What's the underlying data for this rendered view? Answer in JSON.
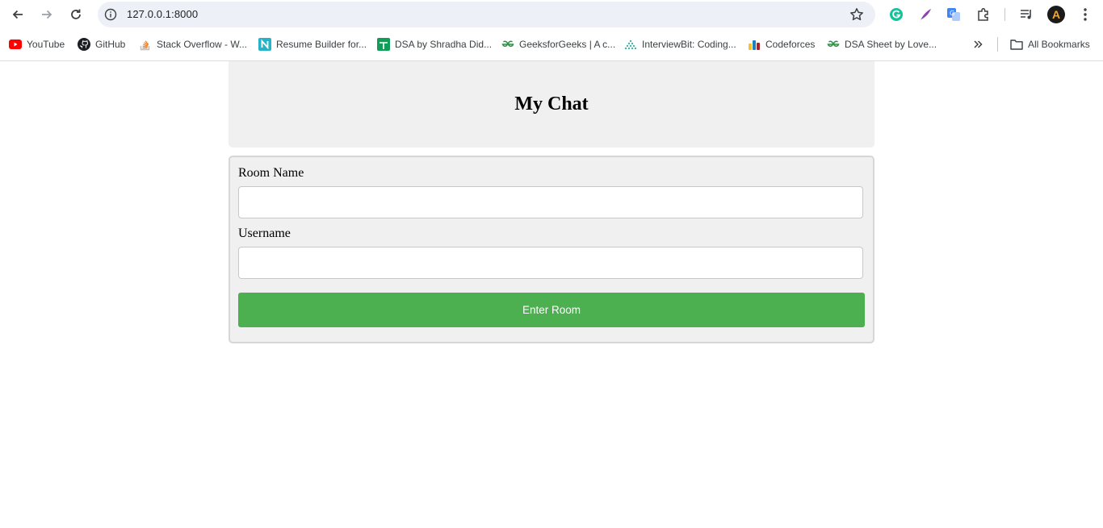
{
  "browser": {
    "url": "127.0.0.1:8000",
    "bookmarks": [
      {
        "label": "YouTube",
        "icon": "youtube-icon"
      },
      {
        "label": "GitHub",
        "icon": "github-icon"
      },
      {
        "label": "Stack Overflow - W...",
        "icon": "stackoverflow-icon"
      },
      {
        "label": "Resume Builder for...",
        "icon": "resume-builder-icon"
      },
      {
        "label": "DSA by Shradha Did...",
        "icon": "sheets-icon"
      },
      {
        "label": "GeeksforGeeks | A c...",
        "icon": "geeksforgeeks-icon"
      },
      {
        "label": "InterviewBit: Coding...",
        "icon": "interviewbit-icon"
      },
      {
        "label": "Codeforces",
        "icon": "codeforces-icon"
      },
      {
        "label": "DSA Sheet by Love...",
        "icon": "geeksforgeeks-icon"
      }
    ],
    "all_bookmarks_label": "All Bookmarks",
    "profile_initial": "A"
  },
  "page": {
    "title": "My Chat",
    "room_label": "Room Name",
    "room_value": "",
    "username_label": "Username",
    "username_value": "",
    "submit_label": "Enter Room"
  },
  "colors": {
    "accent": "#4caf50",
    "panel": "#f0f0f0"
  }
}
